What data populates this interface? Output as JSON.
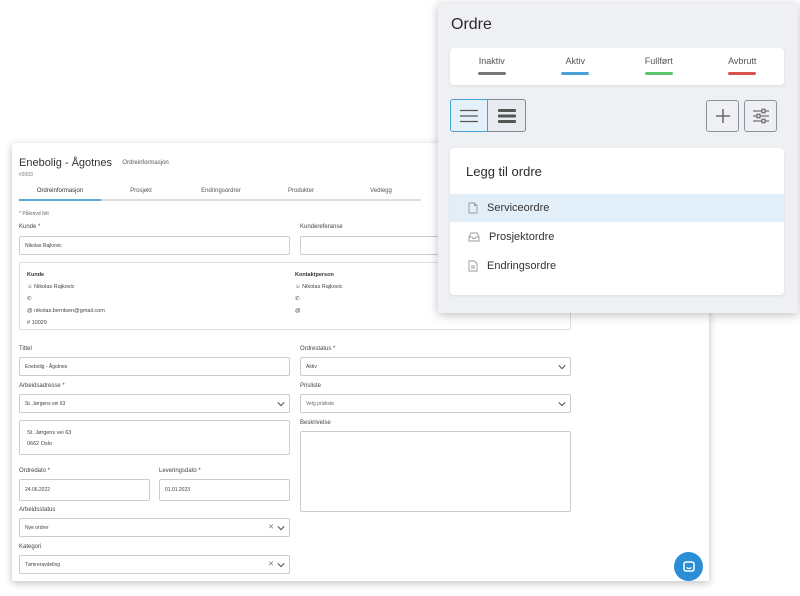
{
  "order": {
    "title": "Enebolig - Ågotnes",
    "subtitle": "Ordreinformasjon",
    "id": "#2003",
    "tabs": [
      "Ordreinformasjon",
      "Prosjekt",
      "Endringsordrer",
      "Produkter",
      "Vedlegg"
    ],
    "required_note": "* Påkrevd felt",
    "labels": {
      "kunde": "Kunde *",
      "kundereferanse": "Kundereferanse",
      "tittel": "Tittel",
      "ordrestatus": "Ordrestatus *",
      "arbeidsadresse": "Arbeidsadresse *",
      "prisliste": "Prisliste",
      "beskrivelse": "Beskrivelse",
      "ordredato": "Ordredato *",
      "leveringsdato": "Leveringsdato *",
      "arbeidsstatus": "Arbeidsstatus",
      "kategori": "Kategori"
    },
    "values": {
      "kunde": "Nikolas Rajkovic",
      "tittel": "Enebolig - Ågotnes",
      "ordrestatus": "Aktiv",
      "arbeidsadresse": "St. Jørgens vei 63",
      "prisliste_placeholder": "Velg prisliste",
      "ordredato": "24.06.2022",
      "leveringsdato": "01.01.2023",
      "arbeidsstatus": "Nye ordrer",
      "kategori": "Tømreravdeling"
    },
    "customer_box": {
      "kunde_heading": "Kunde",
      "kunde_name": "Nikolas Rajkovic",
      "kunde_email": "nikolas.berntsen@gmail.com",
      "kunde_number": "10029",
      "kontakt_heading": "Kontaktperson",
      "kontakt_name": "Nikolas Rajkovic"
    },
    "address_box": {
      "line1": "St. Jørgens vei 63",
      "line2": "0662 Oslo"
    }
  },
  "ordre_panel": {
    "title": "Ordre",
    "statuses": [
      {
        "label": "Inaktiv",
        "color": "#777777"
      },
      {
        "label": "Aktiv",
        "color": "#4aa3d8"
      },
      {
        "label": "Fullført",
        "color": "#5cc56b"
      },
      {
        "label": "Avbrutt",
        "color": "#d9534f"
      }
    ],
    "add_card": {
      "title": "Legg til ordre",
      "items": [
        {
          "label": "Serviceordre",
          "icon": "document-icon"
        },
        {
          "label": "Prosjektordre",
          "icon": "inbox-icon"
        },
        {
          "label": "Endringsordre",
          "icon": "edit-document-icon"
        }
      ]
    }
  }
}
